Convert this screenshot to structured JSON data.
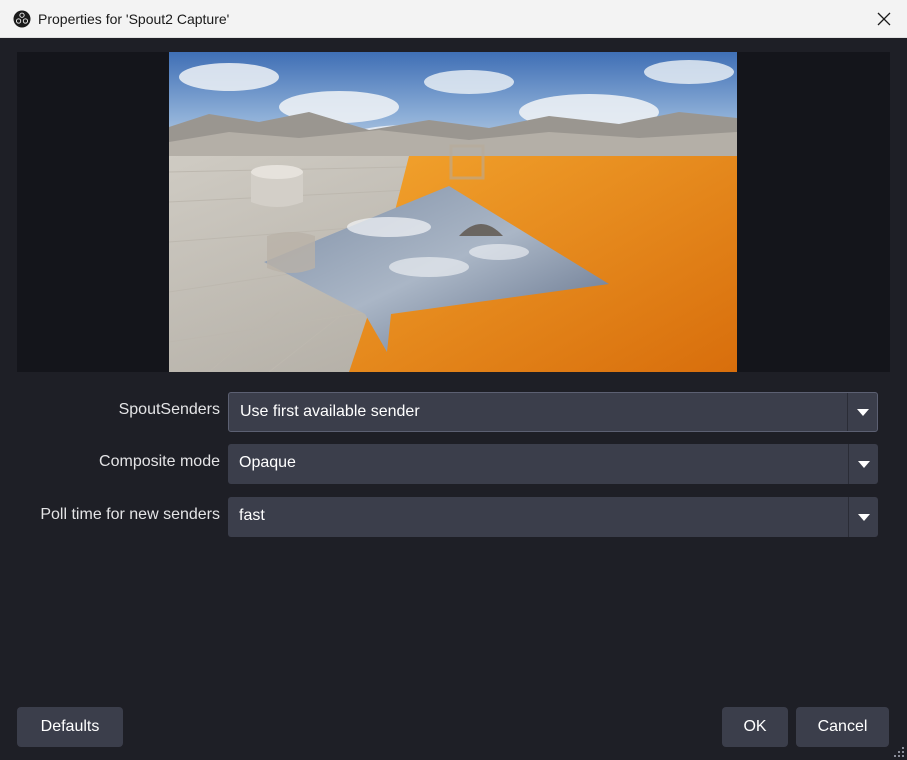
{
  "window": {
    "title": "Properties for 'Spout2 Capture'",
    "app_icon": "obs-icon",
    "close_icon": "close-icon"
  },
  "preview": {
    "description_icon": "preview-image"
  },
  "fields": [
    {
      "label": "SpoutSenders",
      "value": "Use first available sender"
    },
    {
      "label": "Composite mode",
      "value": "Opaque"
    },
    {
      "label": "Poll time for new senders",
      "value": "fast"
    }
  ],
  "buttons": {
    "defaults": "Defaults",
    "ok": "OK",
    "cancel": "Cancel"
  },
  "colors": {
    "background": "#1e1f26",
    "control": "#3b3e4b",
    "preview_bg": "#14151b"
  }
}
